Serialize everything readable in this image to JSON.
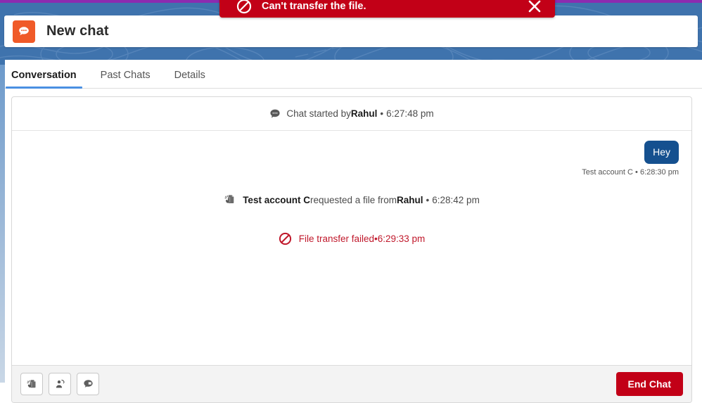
{
  "toast": {
    "icon": "no-entry-icon",
    "message": "Can't transfer the file.",
    "close_label": "✕",
    "color": "#c20017"
  },
  "header": {
    "app_icon": "chat-bubble-icon",
    "title": "New chat",
    "icon_color": "#f05a28"
  },
  "tabs": [
    {
      "label": "Conversation",
      "active": true
    },
    {
      "label": "Past Chats",
      "active": false
    },
    {
      "label": "Details",
      "active": false
    }
  ],
  "conversation": {
    "started": {
      "icon": "chat-bubble-icon",
      "prefix": "Chat started by ",
      "actor": "Rahul",
      "separator": "•",
      "time": "6:27:48 pm"
    },
    "messages": [
      {
        "type": "outgoing",
        "text": "Hey",
        "author": "Test account C",
        "separator": "•",
        "time": "6:28:30 pm",
        "bubble_color": "#15508f"
      },
      {
        "type": "system",
        "icon": "file-request-icon",
        "actor": "Test account C",
        "middle": " requested a file from ",
        "target": "Rahul",
        "separator": "•",
        "time": "6:28:42 pm"
      },
      {
        "type": "error",
        "icon": "no-entry-icon",
        "text": "File transfer failed",
        "separator": "•",
        "time": "6:29:33 pm",
        "color": "#c0182b"
      }
    ]
  },
  "footer": {
    "tools": [
      {
        "name": "request-file-button",
        "icon": "file-request-icon"
      },
      {
        "name": "transfer-chat-button",
        "icon": "person-transfer-icon"
      },
      {
        "name": "quick-text-button",
        "icon": "chat-bubble-icon"
      }
    ],
    "end_chat_label": "End Chat",
    "end_chat_color": "#c20017"
  }
}
